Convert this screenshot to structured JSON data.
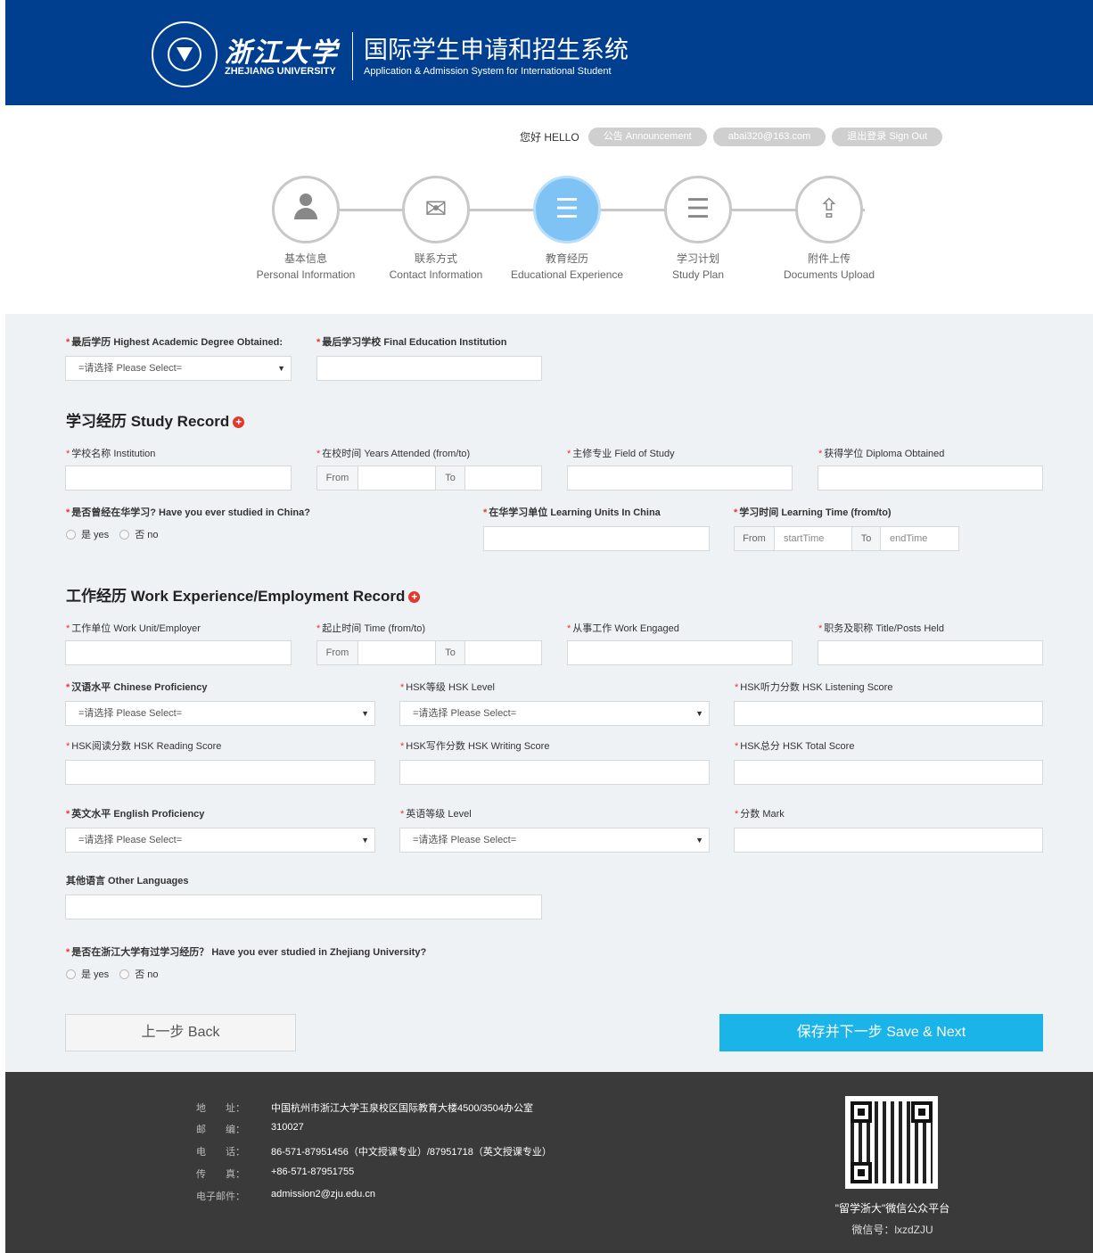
{
  "header": {
    "logo_cn": "浙江大学",
    "logo_en": "ZHEJIANG UNIVERSITY",
    "title": "国际学生申请和招生系统",
    "subtitle": "Application & Admission System for International Student"
  },
  "topbar": {
    "hello": "您好 HELLO",
    "announcement": "公告 Announcement",
    "email": "abai320@163.com",
    "signout": "退出登录 Sign Out"
  },
  "steps": [
    {
      "cn": "基本信息",
      "en": "Personal Information",
      "icon": "person-icon"
    },
    {
      "cn": "联系方式",
      "en": "Contact Information",
      "icon": "envelope-icon"
    },
    {
      "cn": "教育经历",
      "en": "Educational Experience",
      "icon": "document-list-icon",
      "active": true
    },
    {
      "cn": "学习计划",
      "en": "Study Plan",
      "icon": "document-list-icon"
    },
    {
      "cn": "附件上传",
      "en": "Documents Upload",
      "icon": "upload-icon"
    }
  ],
  "form": {
    "highest_degree_label": "最后学历 Highest Academic Degree Obtained:",
    "highest_degree_value": "=请选择 Please Select=",
    "final_institution_label": "最后学习学校 Final Education Institution",
    "study_record_title": "学习经历 Study Record",
    "institution_label": "学校名称 Institution",
    "years_attended_label": "在校时间 Years Attended (from/to)",
    "field_of_study_label": "主修专业 Field of Study",
    "diploma_label": "获得学位 Diploma Obtained",
    "from": "From",
    "to": "To",
    "studied_china_label": "是否曾经在华学习? Have you ever studied in China?",
    "yes": "是 yes",
    "no": "否 no",
    "learning_units_label": "在华学习单位 Learning Units In China",
    "learning_time_label": "学习时间 Learning Time (from/to)",
    "start_time": "startTime",
    "end_time": "endTime",
    "work_title": "工作经历 Work Experience/Employment Record",
    "employer_label": "工作单位 Work Unit/Employer",
    "work_time_label": "起止时间 Time (from/to)",
    "work_engaged_label": "从事工作 Work Engaged",
    "posts_held_label": "职务及职称 Title/Posts Held",
    "chinese_prof_label": "汉语水平 Chinese Proficiency",
    "hsk_level_label": "HSK等级 HSK Level",
    "hsk_listening_label": "HSK听力分数 HSK Listening Score",
    "hsk_reading_label": "HSK阅读分数 HSK Reading Score",
    "hsk_writing_label": "HSK写作分数 HSK Writing Score",
    "hsk_total_label": "HSK总分 HSK Total Score",
    "english_prof_label": "英文水平 English Proficiency",
    "english_level_label": "英语等级 Level",
    "mark_label": "分数 Mark",
    "other_lang_label": "其他语言 Other Languages",
    "studied_zju_label": "是否在浙江大学有过学习经历？ Have you ever studied in Zhejiang University?",
    "please_select": "=请选择 Please Select="
  },
  "buttons": {
    "back": "上一步 Back",
    "next": "保存并下一步 Save & Next"
  },
  "footer": {
    "address_key": "地　　址：",
    "address": "中国杭州市浙江大学玉泉校区国际教育大楼4500/3504办公室",
    "postcode_key": "邮　　编：",
    "postcode": "310027",
    "phone_key": "电　　话：",
    "phone": "86-571-87951456（中文授课专业）/87951718（英文授课专业）",
    "fax_key": "传　　真：",
    "fax": "+86-571-87951755",
    "email_key": "电子邮件：",
    "email": "admission2@zju.edu.cn",
    "qr_caption": "\"留学浙大\"微信公众平台",
    "wechat_id": "微信号：lxzdZJU"
  },
  "colors": {
    "header_bg": "#003f8f",
    "accent": "#1ab4e8",
    "active_step": "#7fc3f5",
    "required_star": "#e33",
    "footer_bg": "#3a3a3a"
  }
}
